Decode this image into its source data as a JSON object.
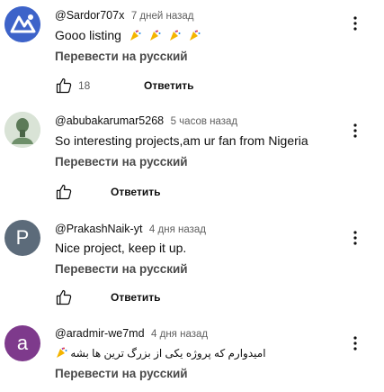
{
  "comments": [
    {
      "author": "@Sardor707x",
      "time": "7 дней назад",
      "text": "Gooo listing",
      "translate": "Перевести на русский",
      "likes": "18",
      "reply": "Ответить",
      "avatar_letter": "",
      "avatar_color": "#3d63c9",
      "emoji_count": 4
    },
    {
      "author": "@abubakarumar5268",
      "time": "5 часов назад",
      "text": "So interesting projects,am ur fan from Nigeria",
      "translate": "Перевести на русский",
      "likes": "",
      "reply": "Ответить",
      "avatar_letter": "",
      "avatar_color": "#6e8f6a"
    },
    {
      "author": "@PrakashNaik-yt",
      "time": "4 дня назад",
      "text": "Nice project, keep it up.",
      "translate": "Перевести на русский",
      "likes": "",
      "reply": "Ответить",
      "avatar_letter": "P",
      "avatar_color": "#5c6b7a"
    },
    {
      "author": "@aradmir-we7md",
      "time": "4 дня назад",
      "text": "امیدوارم که پروژه یکی از بزرگ ترین ها بشه",
      "translate": "Перевести на русский",
      "likes": "",
      "reply": "Ответить",
      "avatar_letter": "a",
      "avatar_color": "#7e3a8c"
    }
  ],
  "icons": {
    "like": "thumbs-up-icon",
    "more": "more-vert-icon",
    "emoji": "party-popper-icon"
  }
}
